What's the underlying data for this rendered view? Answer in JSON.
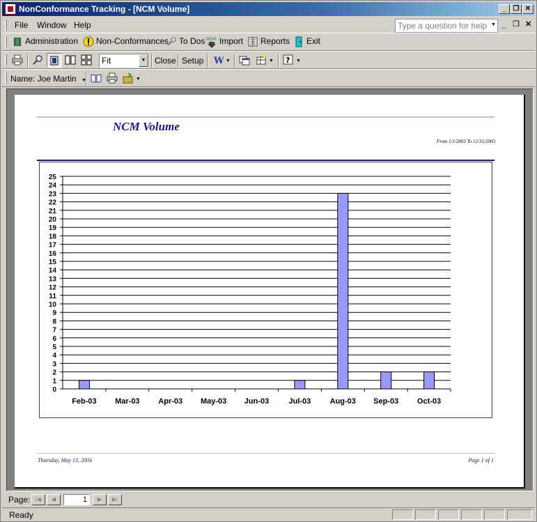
{
  "window": {
    "title": "NonConformance Tracking - [NCM Volume]",
    "min": "_",
    "restore": "❐",
    "close": "✕"
  },
  "menu": {
    "file": "File",
    "window": "Window",
    "help": "Help",
    "help_placeholder": "Type a question for help"
  },
  "toolbar1": {
    "administration": "Administration",
    "nonconformances": "Non-Conformances",
    "todos": "To Dos",
    "import": "Import",
    "reports": "Reports",
    "exit": "Exit",
    "m2m": "M2M"
  },
  "toolbar2": {
    "zoom_value": "Fit",
    "close": "Close",
    "setup": "Setup"
  },
  "toolbar3": {
    "name_label": "Name: Joe Martin"
  },
  "report": {
    "title": "NCM Volume",
    "date_range": "From 1/1/2003 To 12/31/2003",
    "footer_date": "Thursday, May 13, 2004",
    "footer_page": "Page 1 of 1"
  },
  "chart_data": {
    "type": "bar",
    "categories": [
      "Feb-03",
      "Mar-03",
      "Apr-03",
      "May-03",
      "Jun-03",
      "Jul-03",
      "Aug-03",
      "Sep-03",
      "Oct-03"
    ],
    "values": [
      1,
      0,
      0,
      0,
      0,
      1,
      23,
      2,
      2
    ],
    "ylim": [
      0,
      25
    ],
    "yticks": [
      0,
      1,
      2,
      3,
      4,
      5,
      6,
      7,
      8,
      9,
      10,
      11,
      12,
      13,
      14,
      15,
      16,
      17,
      18,
      19,
      20,
      21,
      22,
      23,
      24,
      25
    ],
    "bar_color": "#9999ff",
    "grid": true,
    "title": "",
    "xlabel": "",
    "ylabel": ""
  },
  "pagenav": {
    "label": "Page:",
    "current": "1"
  },
  "status": {
    "text": "Ready"
  }
}
